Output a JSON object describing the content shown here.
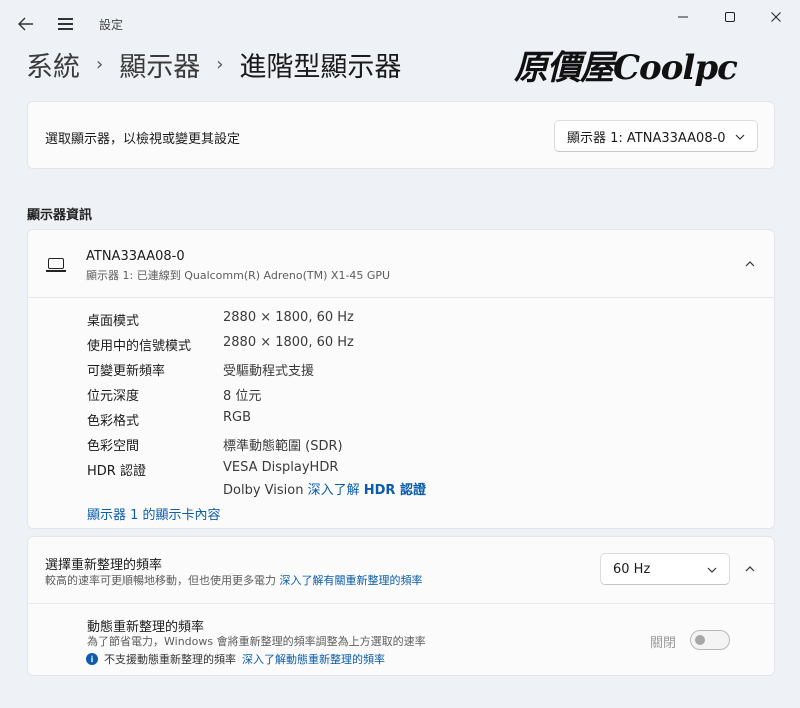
{
  "window": {
    "app_title": "設定",
    "minimize_icon": "minimize-icon",
    "maximize_icon": "maximize-icon",
    "close_icon": "close-icon"
  },
  "breadcrumb": {
    "items": [
      "系統",
      "顯示器",
      "進階型顯示器"
    ],
    "separator": "›"
  },
  "logo": {
    "text": "原價屋Coolpc"
  },
  "display_selector": {
    "label": "選取顯示器，以檢視或變更其設定",
    "selected": "顯示器 1: ATNA33AA08-0"
  },
  "display_info": {
    "section_title": "顯示器資訊",
    "device_name": "ATNA33AA08-0",
    "device_subtitle": "顯示器 1: 已連線到 Qualcomm(R) Adreno(TM) X1-45 GPU",
    "rows": [
      {
        "key": "桌面模式",
        "value": "2880 × 1800, 60 Hz"
      },
      {
        "key": "使用中的信號模式",
        "value": "2880 × 1800, 60 Hz"
      },
      {
        "key": "可變更新頻率",
        "value": "受驅動程式支援"
      },
      {
        "key": "位元深度",
        "value": "8 位元"
      },
      {
        "key": "色彩格式",
        "value": "RGB"
      },
      {
        "key": "色彩空間",
        "value": "標準動態範圍 (SDR)"
      },
      {
        "key": "HDR 認證",
        "value": "VESA DisplayHDR"
      }
    ],
    "hdr_line2_text": "Dolby Vision",
    "hdr_link": "深入了解",
    "hdr_link_bold": "HDR 認證",
    "adapter_link": "顯示器 1 的顯示卡內容"
  },
  "refresh_rate": {
    "title": "選擇重新整理的頻率",
    "subtitle": "較高的速率可更順暢地移動，但也使用更多電力",
    "subtitle_link": "深入了解有關重新整理的頻率",
    "selected": "60 Hz",
    "dynamic_title": "動態重新整理的頻率",
    "dynamic_subtitle": "為了節省電力，Windows 會將重新整理的頻率調整為上方選取的速率",
    "dynamic_note": "不支援動態重新整理的頻率",
    "dynamic_note_link": "深入了解動態重新整理的頻率",
    "toggle_label": "關閉",
    "toggle_state": "off"
  },
  "colors": {
    "accent": "#0b5cad",
    "background": "#eef1f5",
    "card": "#fbfbfb"
  }
}
